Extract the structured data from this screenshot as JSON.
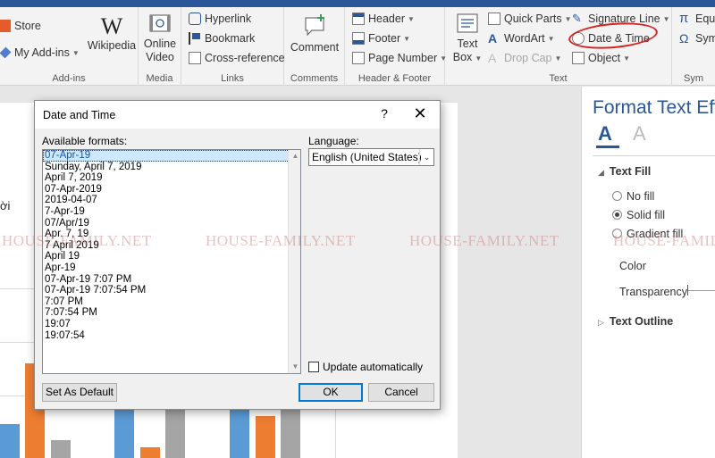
{
  "ribbon": {
    "store": "Store",
    "my_addins": "My Add-ins",
    "wikipedia": "Wikipedia",
    "online_video": [
      "Online",
      "Video"
    ],
    "hyperlink": "Hyperlink",
    "bookmark": "Bookmark",
    "cross_reference": "Cross-reference",
    "comment": "Comment",
    "header": "Header",
    "footer": "Footer",
    "page_number": "Page Number",
    "text_box": [
      "Text",
      "Box"
    ],
    "quick_parts": "Quick Parts",
    "wordart": "WordArt",
    "drop_cap": "Drop Cap",
    "signature_line": "Signature Line",
    "date_time": "Date & Time",
    "object": "Object",
    "equation": "Equ",
    "symbol": "Sym",
    "groups": {
      "addins": "Add-ins",
      "media": "Media",
      "links": "Links",
      "comments": "Comments",
      "header_footer": "Header & Footer",
      "text": "Text",
      "symbols": "Sym"
    }
  },
  "document": {
    "visible_text": "ời"
  },
  "pane": {
    "title": "Format Text Effe",
    "text_fill": "Text Fill",
    "no_fill": "No fill",
    "solid_fill": "Solid fill",
    "gradient_fill": "Gradient fill",
    "color": "Color",
    "transparency": "Transparency",
    "text_outline": "Text Outline"
  },
  "watermark": [
    "HOUSE-FAMILY.NET",
    "HOUSE-FAMILY.NET",
    "HOUSE-FAMILY.NET",
    "HOUSE-FAMILY.NET"
  ],
  "dialog": {
    "title": "Date and Time",
    "help": "?",
    "close": "✕",
    "available_formats_label": "Available formats:",
    "language_label": "Language:",
    "language_value": "English (United States)",
    "formats": [
      "07-Apr-19",
      "Sunday, April 7, 2019",
      "April 7, 2019",
      "07-Apr-2019",
      "2019-04-07",
      "7-Apr-19",
      "07/Apr/19",
      "Apr. 7, 19",
      "7 April 2019",
      "April 19",
      "Apr-19",
      "07-Apr-19 7:07 PM",
      "07-Apr-19 7:07:54 PM",
      "7:07 PM",
      "7:07:54 PM",
      "19:07",
      "19:07:54"
    ],
    "selected_index": 0,
    "update_automatically": "Update automatically",
    "set_as_default": "Set As Default",
    "ok": "OK",
    "cancel": "Cancel"
  },
  "colors": {
    "accent": "#2b579a",
    "bar_blue": "#5b9bd5",
    "bar_orange": "#ed7d31",
    "bar_gray": "#a5a5a5",
    "annotation_red": "#d82222"
  }
}
